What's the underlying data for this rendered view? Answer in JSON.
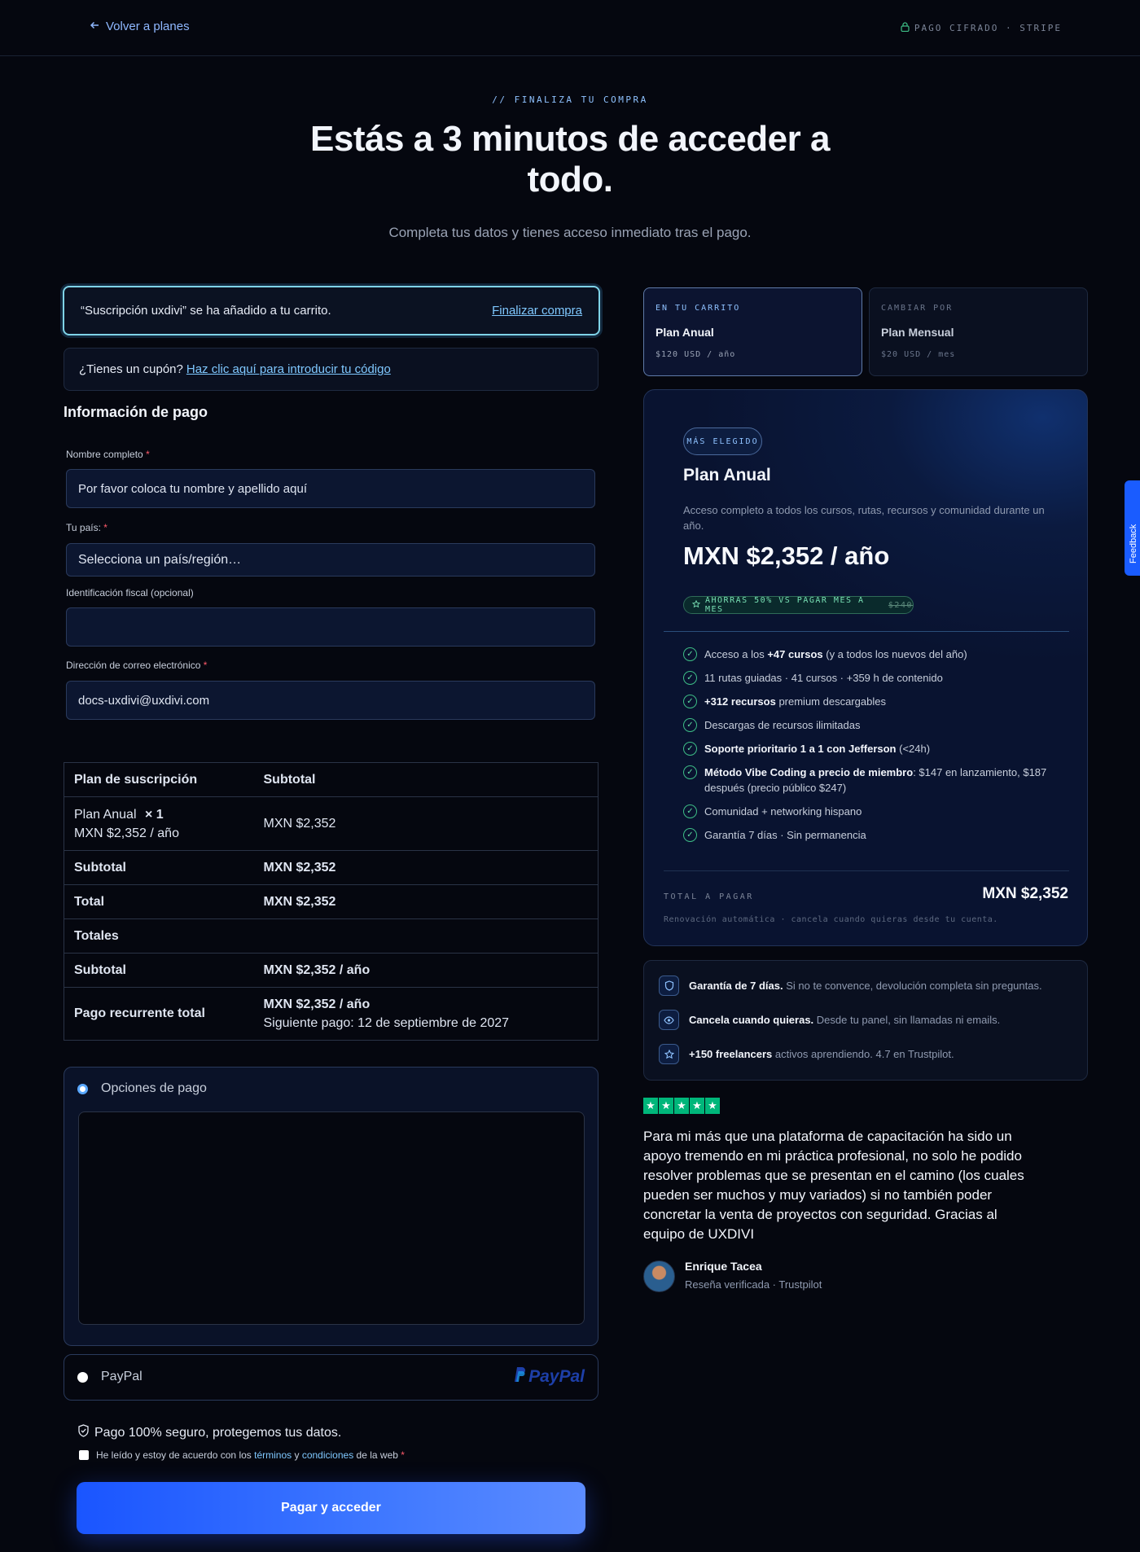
{
  "header": {
    "back_label": "Volver a planes",
    "secure_label": "PAGO CIFRADO · STRIPE"
  },
  "hero": {
    "eyebrow": "// FINALIZA TU COMPRA",
    "title": "Estás a 3 minutos de acceder a todo.",
    "subtitle": "Completa tus datos y tienes acceso inmediato tras el pago."
  },
  "notice": {
    "text": "“Suscripción uxdivi” se ha añadido a tu carrito.",
    "link": "Finalizar compra"
  },
  "coupon": {
    "text": "¿Tienes un cupón?",
    "link": "Haz clic aquí para introducir tu código"
  },
  "form": {
    "title": "Información de pago",
    "name": {
      "label": "Nombre completo",
      "req": "*",
      "placeholder": "Por favor coloca tu nombre y apellido aquí"
    },
    "country": {
      "label": "Tu país:",
      "req": "*",
      "value": "Selecciona un país/región…"
    },
    "tax": {
      "label": "Identificación fiscal (opcional)",
      "value": ""
    },
    "email": {
      "label": "Dirección de correo electrónico",
      "req": "*",
      "value": "docs-uxdivi@uxdivi.com"
    }
  },
  "order": {
    "head": [
      "Plan de suscripción",
      "Subtotal"
    ],
    "item": {
      "name": "Plan Anual",
      "qty": "× 1",
      "sub": "MXN $2,352 / año",
      "price": "MXN $2,352"
    },
    "subtotal": [
      "Subtotal",
      "MXN $2,352"
    ],
    "total": [
      "Total",
      "MXN $2,352"
    ],
    "totals_heading": "Totales",
    "rec_subtotal": [
      "Subtotal",
      "MXN $2,352 / año"
    ],
    "recurring": {
      "label": "Pago recurrente total",
      "value": "MXN $2,352 / año",
      "next": "Siguiente pago: 12 de septiembre de 2027"
    }
  },
  "payment": {
    "option1": "Opciones de pago",
    "option2": "PayPal",
    "paypal_logo": "PayPal",
    "secure_text": "Pago 100% seguro, protegemos tus datos.",
    "terms_pre": "He leído y estoy de acuerdo con los",
    "terms_link1": "términos",
    "terms_and": "y",
    "terms_link2": "condiciones",
    "terms_post": "de la web",
    "terms_req": "*",
    "button": "Pagar y acceder"
  },
  "plan_tabs": [
    {
      "eyebrow": "EN TU CARRITO",
      "name": "Plan Anual",
      "price": "$120 USD / año"
    },
    {
      "eyebrow": "CAMBIAR POR",
      "name": "Plan Mensual",
      "price": "$20 USD / mes"
    }
  ],
  "plan_card": {
    "badge": "MÁS ELEGIDO",
    "title": "Plan Anual",
    "desc": "Acceso completo a todos los cursos, rutas, recursos y comunidad durante un año.",
    "price": "MXN $2,352 / año",
    "save_text": "AHORRAS 50% VS PAGAR MES A MES",
    "save_old": "$240",
    "features": [
      {
        "pre": "Acceso a los ",
        "bold": "+47 cursos",
        "post": " (y a todos los nuevos del año)"
      },
      {
        "pre": "11 rutas guiadas · 41 cursos · +359 h de contenido",
        "bold": "",
        "post": ""
      },
      {
        "pre": "",
        "bold": "+312 recursos",
        "post": " premium descargables"
      },
      {
        "pre": "Descargas de recursos ilimitadas",
        "bold": "",
        "post": ""
      },
      {
        "pre": "",
        "bold": "Soporte prioritario 1 a 1 con Jefferson",
        "post": " (<24h)"
      },
      {
        "pre": "",
        "bold": "Método Vibe Coding a precio de miembro",
        "post": ": $147 en lanzamiento, $187 después (precio público $247)"
      },
      {
        "pre": "Comunidad + networking hispano",
        "bold": "",
        "post": ""
      },
      {
        "pre": "Garantía 7 días · Sin permanencia",
        "bold": "",
        "post": ""
      }
    ],
    "total_label": "TOTAL A PAGAR",
    "total_value": "MXN $2,352",
    "renewal": "Renovación automática · cancela cuando quieras desde tu cuenta."
  },
  "guarantees": [
    {
      "bold": "Garantía de 7 días.",
      "text": " Si no te convence, devolución completa sin preguntas.",
      "icon": "shield-icon"
    },
    {
      "bold": "Cancela cuando quieras.",
      "text": " Desde tu panel, sin llamadas ni emails.",
      "icon": "eye-icon"
    },
    {
      "bold": "+150 freelancers",
      "text": " activos aprendiendo. 4.7 en Trustpilot.",
      "icon": "star-icon"
    }
  ],
  "review": {
    "text": "Para mi más que una plataforma de capacitación ha sido un apoyo tremendo en mi práctica profesional, no solo he podido resolver problemas que se presentan en el camino (los cuales pueden ser muchos y muy variados) si no también poder concretar la venta de proyectos con seguridad. Gracias al equipo de UXDIVI",
    "author": "Enrique Tacea",
    "meta": "Reseña verificada · Trustpilot",
    "rating": 5
  },
  "feedback": "Feedback",
  "colors": {
    "accent": "#1a55ff",
    "link": "#7fc8ff",
    "success": "#00b67a",
    "background": "#05070f"
  }
}
